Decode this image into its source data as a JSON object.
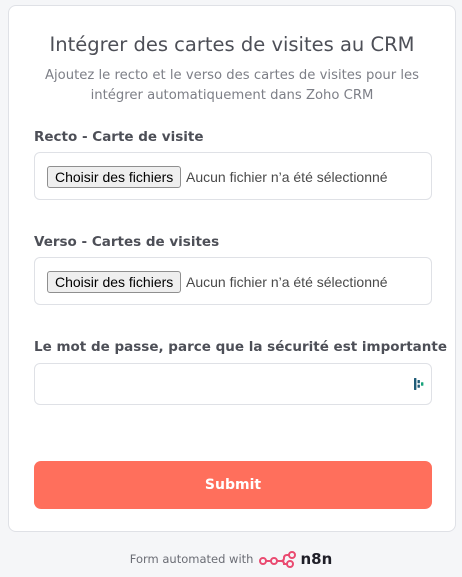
{
  "form": {
    "title": "Intégrer des cartes de visites au CRM",
    "subtitle": "Ajoutez le recto et le verso des cartes de visites pour les intégrer automatiquement dans Zoho CRM",
    "fields": [
      {
        "label": "Recto - Carte de visite",
        "button_label": "Choisir des fichiers",
        "status_text": "Aucun fichier n’a été sélectionné"
      },
      {
        "label": "Verso - Cartes de visites",
        "button_label": "Choisir des fichiers",
        "status_text": "Aucun fichier n’a été sélectionné"
      }
    ],
    "password": {
      "label": "Le mot de passe, parce que la sécurité est importante",
      "value": "",
      "icon": "password-manager-icon"
    },
    "submit_label": "Submit"
  },
  "footer": {
    "text": "Form automated with",
    "brand": "n8n",
    "brand_color": "#ea4b71"
  },
  "colors": {
    "accent": "#ff6f5c",
    "border": "#dfe1e6",
    "text": "#4d4f57"
  }
}
